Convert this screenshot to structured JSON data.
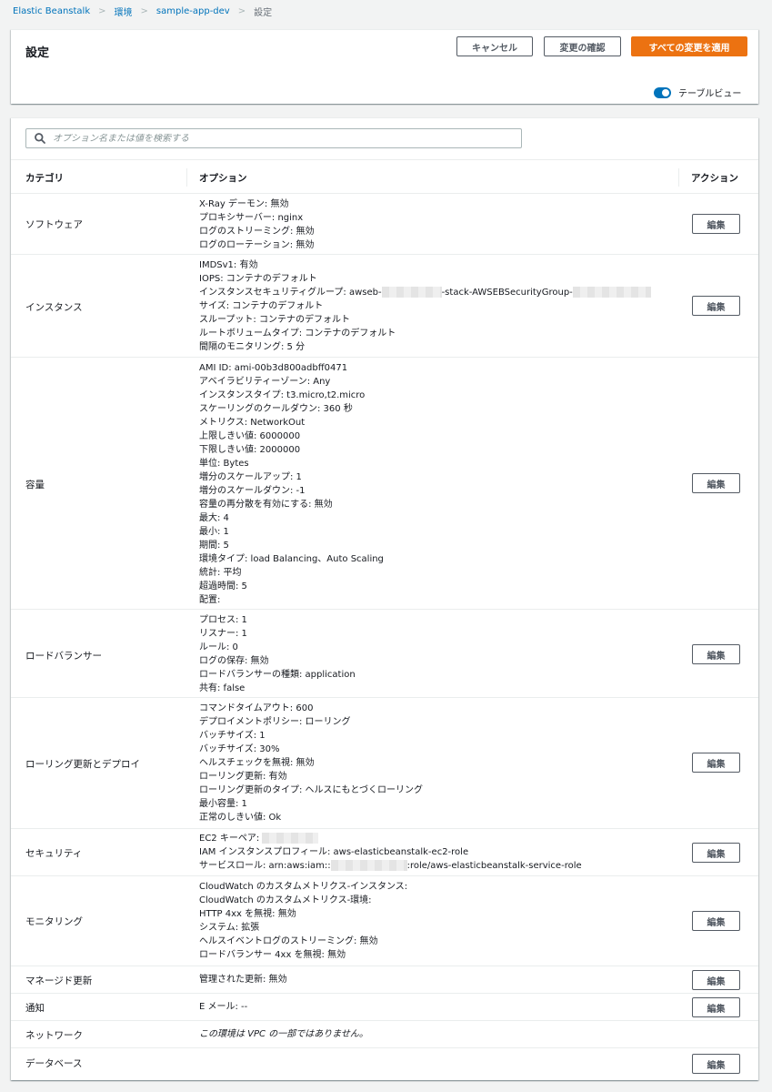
{
  "breadcrumb": {
    "items": [
      "Elastic Beanstalk",
      "環境",
      "sample-app-dev",
      "設定"
    ]
  },
  "header": {
    "title": "設定",
    "cancel_label": "キャンセル",
    "review_label": "変更の確認",
    "apply_label": "すべての変更を適用",
    "table_view_label": "テーブルビュー",
    "table_view_on": true,
    "accent_color": "#ec7211",
    "link_color": "#0073bb"
  },
  "search": {
    "placeholder": "オプション名または値を検索する"
  },
  "table": {
    "columns": [
      "カテゴリ",
      "オプション",
      "アクション"
    ],
    "edit_label": "編集",
    "rows": [
      {
        "category": "ソフトウェア",
        "options": [
          "X-Ray デーモン: 無効",
          "プロキシサーバー: nginx",
          "ログのストリーミング: 無効",
          "ログのローテーション: 無効"
        ]
      },
      {
        "category": "インスタンス",
        "options": [
          "IMDSv1: 有効",
          "IOPS: コンテナのデフォルト",
          "インスタンスセキュリティグループ: awseb-",
          "-stack-AWSEBSecurityGroup-",
          "サイズ: コンテナのデフォルト",
          "スループット: コンテナのデフォルト",
          "ルートボリュームタイプ: コンテナのデフォルト",
          "間隔のモニタリング: 5 分"
        ]
      },
      {
        "category": "容量",
        "options": [
          "AMI ID: ami-00b3d800adbff0471",
          "アベイラビリティーゾーン: Any",
          "インスタンスタイプ: t3.micro,t2.micro",
          "スケーリングのクールダウン: 360 秒",
          "メトリクス: NetworkOut",
          "上限しきい値: 6000000",
          "下限しきい値: 2000000",
          "単位: Bytes",
          "増分のスケールアップ: 1",
          "増分のスケールダウン: -1",
          "容量の再分散を有効にする: 無効",
          "最大: 4",
          "最小: 1",
          "期間: 5",
          "環境タイプ: load Balancing、Auto Scaling",
          "統計: 平均",
          "超過時間: 5",
          "配置:"
        ]
      },
      {
        "category": "ロードバランサー",
        "options": [
          "プロセス: 1",
          "リスナー: 1",
          "ルール: 0",
          "ログの保存: 無効",
          "ロードバランサーの種類: application",
          "共有: false"
        ]
      },
      {
        "category": "ローリング更新とデプロイ",
        "options": [
          "コマンドタイムアウト: 600",
          "デプロイメントポリシー: ローリング",
          "バッチサイズ: 1",
          "バッチサイズ: 30%",
          "ヘルスチェックを無視: 無効",
          "ローリング更新: 有効",
          "ローリング更新のタイプ: ヘルスにもとづくローリング",
          "最小容量: 1",
          "正常のしきい値: Ok"
        ]
      },
      {
        "category": "セキュリティ",
        "options": [
          "EC2 キーペア: ",
          "IAM インスタンスプロフィール: aws-elasticbeanstalk-ec2-role",
          "サービスロール: arn:aws:iam::",
          ":role/aws-elasticbeanstalk-service-role"
        ]
      },
      {
        "category": "モニタリング",
        "options": [
          "CloudWatch のカスタムメトリクス-インスタンス:",
          "CloudWatch のカスタムメトリクス-環境:",
          "HTTP 4xx を無視: 無効",
          "システム: 拡張",
          "ヘルスイベントログのストリーミング: 無効",
          "ロードバランサー 4xx を無視: 無効"
        ]
      },
      {
        "category": "マネージド更新",
        "options": [
          "管理された更新: 無効"
        ]
      },
      {
        "category": "通知",
        "options": [
          "E メール: --"
        ]
      },
      {
        "category": "ネットワーク",
        "options": [
          "この環境は VPC の一部ではありません。"
        ]
      },
      {
        "category": "データベース",
        "options": []
      }
    ]
  }
}
